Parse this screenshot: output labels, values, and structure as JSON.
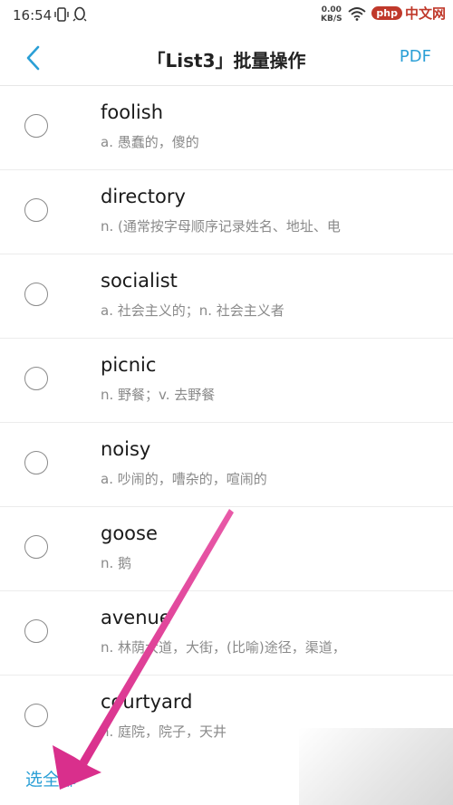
{
  "status_bar": {
    "time": "16:54",
    "net_speed_top": "0.00",
    "net_speed_bottom": "KB/S"
  },
  "watermark": {
    "badge": "php",
    "text": "中文网"
  },
  "header": {
    "title": "「List3」批量操作",
    "pdf_label": "PDF"
  },
  "words": [
    {
      "word": "foolish",
      "definition": "a. 愚蠢的，傻的"
    },
    {
      "word": "directory",
      "definition": "n. (通常按字母顺序记录姓名、地址、电"
    },
    {
      "word": "socialist",
      "definition": "a. 社会主义的；n. 社会主义者"
    },
    {
      "word": "picnic",
      "definition": "n. 野餐；v. 去野餐"
    },
    {
      "word": "noisy",
      "definition": "a. 吵闹的，嘈杂的，喧闹的"
    },
    {
      "word": "goose",
      "definition": "n. 鹅"
    },
    {
      "word": "avenue",
      "definition": "n. 林荫大道，大街，(比喻)途径，渠道，"
    },
    {
      "word": "courtyard",
      "definition": "n. 庭院，院子，天井"
    }
  ],
  "footer": {
    "select_all_label": "选全部"
  },
  "colors": {
    "accent": "#2a9fd6",
    "annotation_arrow": "#e0439a"
  },
  "icons": {
    "back": "chevron-left-icon",
    "vibrate": "vibrate-icon",
    "notification": "qq-icon",
    "wifi": "wifi-icon"
  }
}
